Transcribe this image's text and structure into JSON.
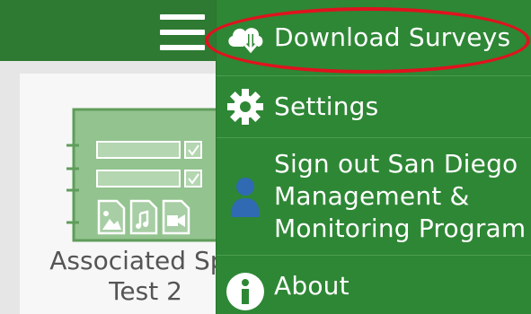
{
  "header": {
    "menu_icon": "hamburger-menu-icon",
    "bar_color": "#2e7a32"
  },
  "survey_card": {
    "title_line1": "Associated Spe",
    "title_line2": "Test 2",
    "thumbnail_icon": "survey-form-icon"
  },
  "drawer": {
    "background": "#2e8735",
    "items": [
      {
        "label": "Download Surveys",
        "icon": "cloud-download-icon"
      },
      {
        "label": "Settings",
        "icon": "gear-icon"
      },
      {
        "label_lines": [
          "Sign out San Diego",
          "Management &",
          "Monitoring Program"
        ],
        "icon": "user-icon"
      },
      {
        "label": "About",
        "icon": "info-icon"
      }
    ]
  },
  "annotation": {
    "color": "#e0121e"
  }
}
